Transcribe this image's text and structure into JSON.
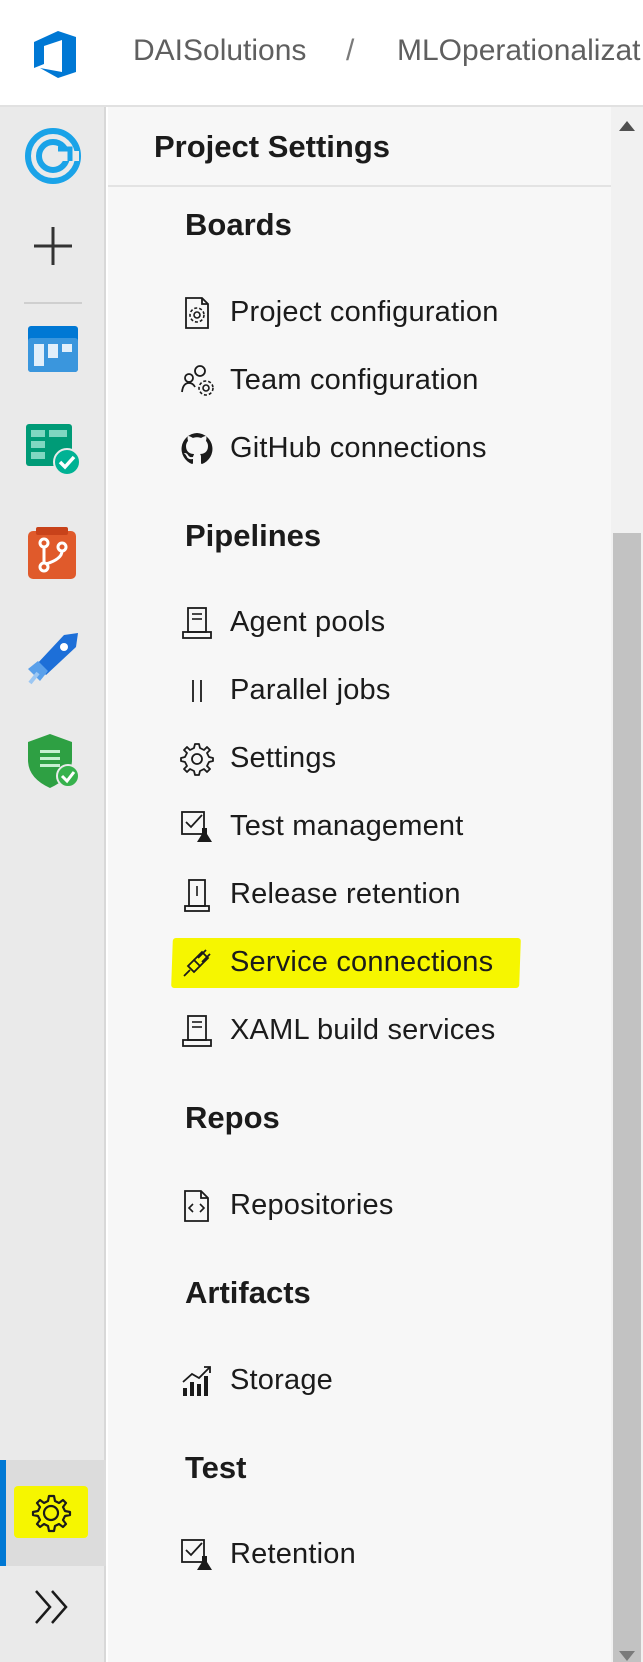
{
  "header": {
    "organization": "DAISolutions",
    "separator": "/",
    "project": "MLOperationalizat",
    "logo_icon": "azure-devops-logo-icon"
  },
  "rail": {
    "items": [
      {
        "name": "overview-icon",
        "color": "#1aa3e8"
      },
      {
        "name": "new-plus-icon",
        "color": "#333333"
      },
      {
        "name": "boards-icon",
        "color": "#0078d4"
      },
      {
        "name": "test-plans-icon",
        "color": "#009b77"
      },
      {
        "name": "repos-icon",
        "color": "#e05a2b"
      },
      {
        "name": "pipelines-icon",
        "color": "#1d6fd8"
      },
      {
        "name": "security-shield-icon",
        "color": "#2ea043"
      }
    ],
    "settings_icon": "gear-icon",
    "expand_icon": "double-chevron-right-icon"
  },
  "panel": {
    "title": "Project Settings",
    "sections": [
      {
        "title": "Boards",
        "items": [
          {
            "label": "Project configuration",
            "icon": "gear-document-icon"
          },
          {
            "label": "Team configuration",
            "icon": "team-gear-icon"
          },
          {
            "label": "GitHub connections",
            "icon": "github-icon"
          }
        ]
      },
      {
        "title": "Pipelines",
        "items": [
          {
            "label": "Agent pools",
            "icon": "agent-pool-icon"
          },
          {
            "label": "Parallel jobs",
            "icon": "parallel-jobs-icon"
          },
          {
            "label": "Settings",
            "icon": "gear-icon"
          },
          {
            "label": "Test management",
            "icon": "test-management-icon"
          },
          {
            "label": "Release retention",
            "icon": "release-retention-icon"
          },
          {
            "label": "Service connections",
            "icon": "plug-icon"
          },
          {
            "label": "XAML build services",
            "icon": "xaml-build-icon"
          }
        ]
      },
      {
        "title": "Repos",
        "items": [
          {
            "label": "Repositories",
            "icon": "code-document-icon"
          }
        ]
      },
      {
        "title": "Artifacts",
        "items": [
          {
            "label": "Storage",
            "icon": "storage-chart-icon"
          }
        ]
      },
      {
        "title": "Test",
        "items": [
          {
            "label": "Retention",
            "icon": "test-retention-icon"
          }
        ]
      }
    ]
  },
  "colors": {
    "highlight": "#f6f600",
    "accent": "#0078d4",
    "rail_bg": "#eaeaea",
    "panel_bg": "#f7f7f7"
  }
}
